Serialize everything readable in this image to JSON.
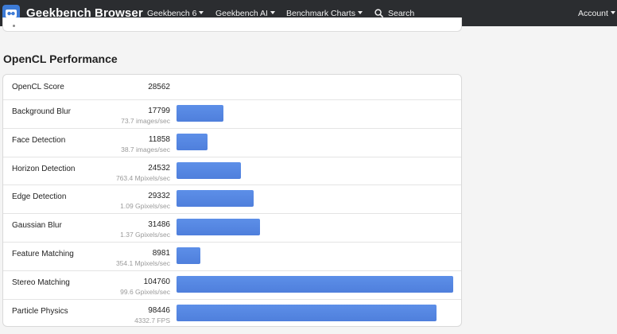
{
  "navbar": {
    "brand": "Geekbench Browser",
    "items": [
      {
        "label": "Geekbench 6",
        "has_caret": true
      },
      {
        "label": "Geekbench AI",
        "has_caret": true
      },
      {
        "label": "Benchmark Charts",
        "has_caret": true
      }
    ],
    "search_label": "Search",
    "account_label": "Account",
    "icons": {
      "logo": "geekbench-logo-icon",
      "search": "search-icon",
      "caret": "caret-down-icon"
    }
  },
  "section": {
    "title": "OpenCL Performance"
  },
  "score": {
    "label": "OpenCL Score",
    "value": "28562"
  },
  "workloads": [
    {
      "name": "Background Blur",
      "score": "17799",
      "detail": "73.7 images/sec",
      "value": 17799
    },
    {
      "name": "Face Detection",
      "score": "11858",
      "detail": "38.7 images/sec",
      "value": 11858
    },
    {
      "name": "Horizon Detection",
      "score": "24532",
      "detail": "763.4 Mpixels/sec",
      "value": 24532
    },
    {
      "name": "Edge Detection",
      "score": "29332",
      "detail": "1.09 Gpixels/sec",
      "value": 29332
    },
    {
      "name": "Gaussian Blur",
      "score": "31486",
      "detail": "1.37 Gpixels/sec",
      "value": 31486
    },
    {
      "name": "Feature Matching",
      "score": "8981",
      "detail": "354.1 Mpixels/sec",
      "value": 8981
    },
    {
      "name": "Stereo Matching",
      "score": "104760",
      "detail": "99.6 Gpixels/sec",
      "value": 104760
    },
    {
      "name": "Particle Physics",
      "score": "98446",
      "detail": "4332.7 FPS",
      "value": 98446
    }
  ],
  "colors": {
    "navbar_bg": "#2b2d30",
    "bar": "#5487e3",
    "accent": "#3d7bd6"
  }
}
